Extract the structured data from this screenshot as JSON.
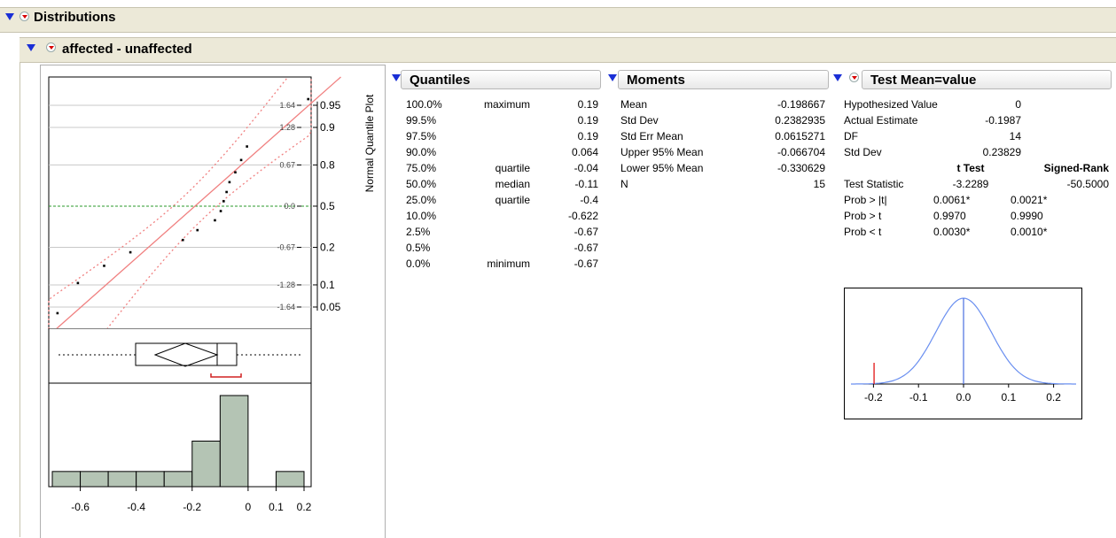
{
  "titles": {
    "distributions": "Distributions",
    "variable": "affected - unaffected",
    "normal_quantile_plot": "Normal Quantile Plot"
  },
  "quantile_plot": {
    "left_ticks": [
      "1.64",
      "1.28",
      "0.67",
      "0.0",
      "-0.67",
      "-1.28",
      "-1.64"
    ],
    "right_ticks": [
      "0.95",
      "0.9",
      "0.8",
      "0.5",
      "0.2",
      "0.1",
      "0.05"
    ]
  },
  "histogram": {
    "x_ticks": [
      "-0.6",
      "-0.4",
      "-0.2",
      "0",
      "0.1",
      "0.2"
    ]
  },
  "quantiles": {
    "title": "Quantiles",
    "rows": [
      {
        "pct": "100.0%",
        "label": "maximum",
        "value": "0.19"
      },
      {
        "pct": "99.5%",
        "label": "",
        "value": "0.19"
      },
      {
        "pct": "97.5%",
        "label": "",
        "value": "0.19"
      },
      {
        "pct": "90.0%",
        "label": "",
        "value": "0.064"
      },
      {
        "pct": "75.0%",
        "label": "quartile",
        "value": "-0.04"
      },
      {
        "pct": "50.0%",
        "label": "median",
        "value": "-0.11"
      },
      {
        "pct": "25.0%",
        "label": "quartile",
        "value": "-0.4"
      },
      {
        "pct": "10.0%",
        "label": "",
        "value": "-0.622"
      },
      {
        "pct": "2.5%",
        "label": "",
        "value": "-0.67"
      },
      {
        "pct": "0.5%",
        "label": "",
        "value": "-0.67"
      },
      {
        "pct": "0.0%",
        "label": "minimum",
        "value": "-0.67"
      }
    ]
  },
  "moments": {
    "title": "Moments",
    "rows": [
      {
        "label": "Mean",
        "value": "-0.198667"
      },
      {
        "label": "Std Dev",
        "value": "0.2382935"
      },
      {
        "label": "Std Err Mean",
        "value": "0.0615271"
      },
      {
        "label": "Upper 95% Mean",
        "value": "-0.066704"
      },
      {
        "label": "Lower 95% Mean",
        "value": "-0.330629"
      },
      {
        "label": "N",
        "value": "15"
      }
    ]
  },
  "test_mean": {
    "title": "Test Mean=value",
    "rows": [
      {
        "label": "Hypothesized Value",
        "value": "0"
      },
      {
        "label": "Actual Estimate",
        "value": "-0.1987"
      },
      {
        "label": "DF",
        "value": "14"
      },
      {
        "label": "Std Dev",
        "value": "0.23829"
      }
    ],
    "col_t": "t Test",
    "col_sr": "Signed-Rank",
    "stats": [
      {
        "label": "Test Statistic",
        "t": "-3.2289",
        "sr": "-50.5000"
      },
      {
        "label": "Prob > |t|",
        "t": "0.0061*",
        "sr": "0.0021*"
      },
      {
        "label": "Prob > t",
        "t": "0.9970",
        "sr": "0.9990"
      },
      {
        "label": "Prob < t",
        "t": "0.0030*",
        "sr": "0.0010*"
      }
    ],
    "density_ticks": [
      "-0.2",
      "-0.1",
      "0.0",
      "0.1",
      "0.2"
    ]
  },
  "chart_data": [
    {
      "type": "scatter",
      "title": "",
      "ylabel": "Normal Quantile Plot",
      "points": [
        {
          "x": -0.67,
          "z": -1.74
        },
        {
          "x": -0.6,
          "z": -1.25
        },
        {
          "x": -0.51,
          "z": -0.97
        },
        {
          "x": -0.42,
          "z": -0.75
        },
        {
          "x": -0.24,
          "z": -0.55
        },
        {
          "x": -0.19,
          "z": -0.39
        },
        {
          "x": -0.13,
          "z": -0.23
        },
        {
          "x": -0.11,
          "z": -0.08
        },
        {
          "x": -0.1,
          "z": 0.08
        },
        {
          "x": -0.09,
          "z": 0.23
        },
        {
          "x": -0.08,
          "z": 0.39
        },
        {
          "x": -0.06,
          "z": 0.55
        },
        {
          "x": -0.04,
          "z": 0.75
        },
        {
          "x": -0.02,
          "z": 0.97
        },
        {
          "x": 0.19,
          "z": 1.74
        }
      ],
      "xlim": [
        -0.7,
        0.2
      ],
      "ylim": [
        -2.0,
        2.1
      ]
    },
    {
      "type": "bar",
      "title": "",
      "xlabel": "",
      "bins": [
        {
          "from": -0.7,
          "to": -0.6,
          "count": 1
        },
        {
          "from": -0.6,
          "to": -0.5,
          "count": 1
        },
        {
          "from": -0.5,
          "to": -0.4,
          "count": 1
        },
        {
          "from": -0.4,
          "to": -0.3,
          "count": 1
        },
        {
          "from": -0.3,
          "to": -0.2,
          "count": 1
        },
        {
          "from": -0.2,
          "to": -0.1,
          "count": 3
        },
        {
          "from": -0.1,
          "to": 0.0,
          "count": 6
        },
        {
          "from": 0.0,
          "to": 0.1,
          "count": 0
        },
        {
          "from": 0.1,
          "to": 0.2,
          "count": 1
        }
      ],
      "xlim": [
        -0.7,
        0.2
      ]
    },
    {
      "type": "line",
      "title": "",
      "series": [
        {
          "values": "normal density centered at 0"
        }
      ],
      "xlim": [
        -0.25,
        0.25
      ],
      "x_ticks": [
        -0.2,
        -0.1,
        0.0,
        0.1,
        0.2
      ],
      "marker_at": -0.1987
    }
  ],
  "colors": {
    "header_bg": "#ece9d8",
    "fit_line": "#f08080",
    "hist_bar": "#b4c4b4",
    "density": "#6a8ff0",
    "mean_line": "#4a6fe0",
    "marker": "#e00000"
  }
}
